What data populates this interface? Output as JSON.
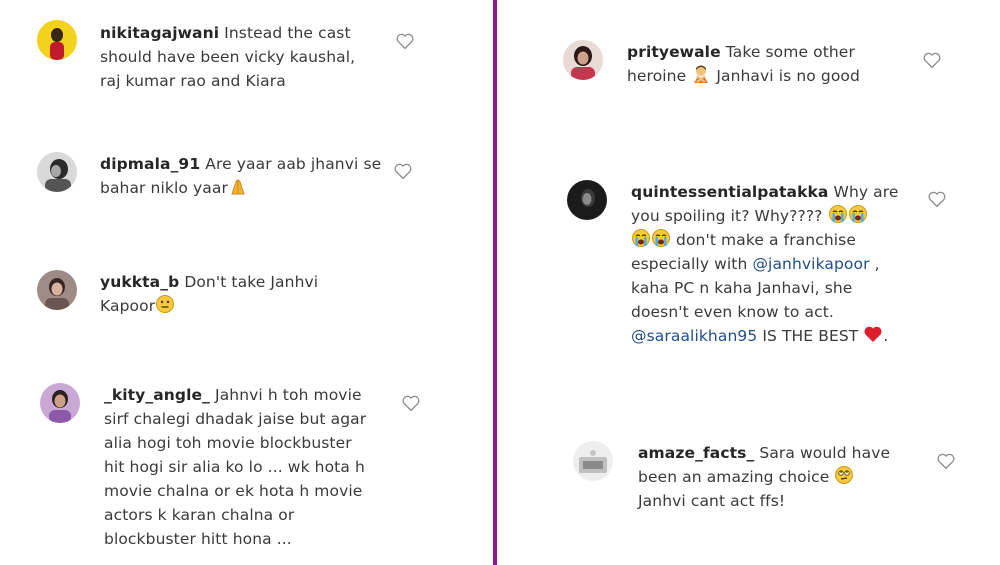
{
  "colors": {
    "divider": "#8e1a92",
    "username": "#262626",
    "text": "#3a3a3a",
    "mention": "#1f4e8c",
    "heart_outline": "#8a8a8a"
  },
  "left_comments": [
    {
      "username": "nikitagajwani",
      "lines": [
        "Instead the cast",
        "should have been vicky kaushal,",
        "raj kumar rao and Kiara"
      ]
    },
    {
      "username": "dipmala_91",
      "lines": [
        "Are yaar aab jhanvi se",
        "bahar niklo yaar"
      ],
      "emoji": "folded-hands-icon"
    },
    {
      "username": "yukkta_b",
      "lines": [
        "Don't take Janhvi",
        "Kapoor"
      ],
      "emoji": "neutral-face-icon"
    },
    {
      "username": "_kity_angle_",
      "lines": [
        "Jahnvi h toh movie",
        "sirf chalegi dhadak jaise but agar",
        "alia hogi toh movie blockbuster",
        "hit hogi sir alia ko lo ... wk hota h",
        "movie chalna or ek hota h movie",
        "actors k karan chalna or",
        "blockbuster hitt hona ..."
      ]
    }
  ],
  "right_comments": [
    {
      "username": "prityewale",
      "lines": [
        "Take some other",
        "heroine",
        "Janhavi is no good"
      ],
      "emoji": "person-gesturing-no-icon"
    },
    {
      "username": "quintessentialpatakka",
      "lines": [
        "Why are",
        "you spoiling it? Why????",
        "don't make a franchise",
        "especially with",
        ",",
        "kaha PC n kaha Janhavi, she",
        "doesn't even know to act.",
        "IS THE BEST",
        "."
      ],
      "mentions": [
        "@janhvikapoor",
        "@saraalikhan95"
      ],
      "emoji": [
        "loudly-crying-face-icon",
        "red-heart-icon"
      ]
    },
    {
      "username": "amaze_facts_",
      "lines": [
        "Sara would have",
        "been an amazing choice",
        "Janhvi cant act ffs!"
      ],
      "emoji": "face-with-rolling-eyes-icon"
    }
  ]
}
